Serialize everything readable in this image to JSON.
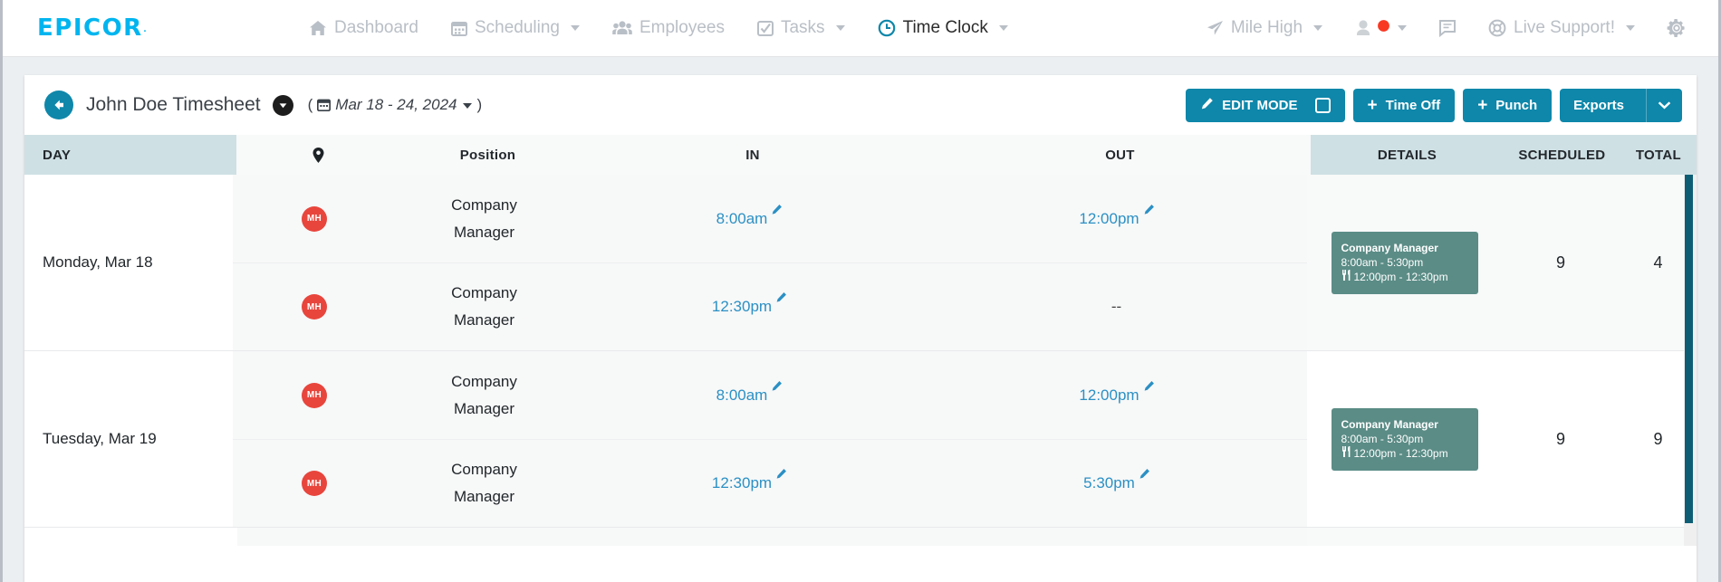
{
  "brand": {
    "logo": "EPICOR",
    "logo_color": "#00b5ef"
  },
  "topnav": {
    "items": [
      {
        "label": "Dashboard",
        "icon": "home-icon",
        "caret": false,
        "active": false
      },
      {
        "label": "Scheduling",
        "icon": "calendar-icon",
        "caret": true,
        "active": false
      },
      {
        "label": "Employees",
        "icon": "users-icon",
        "caret": false,
        "active": false
      },
      {
        "label": "Tasks",
        "icon": "check-square-icon",
        "caret": true,
        "active": false
      },
      {
        "label": "Time Clock",
        "icon": "clock-icon",
        "caret": true,
        "active": true
      }
    ],
    "right": {
      "location_label": "Mile High",
      "location_icon": "paper-plane-icon",
      "user_icon": "user-avatar-icon",
      "status_dot_color": "#f93822",
      "messages_icon": "chat-icon",
      "support_label": "Live Support!",
      "support_icon": "life-ring-icon",
      "settings_icon": "gear-icon"
    }
  },
  "timesheet": {
    "back_icon": "back-arrow-icon",
    "title": "John Doe Timesheet",
    "title_chevron_icon": "chevron-down-circle-icon",
    "date_open_paren": "(",
    "date_close_paren": ")",
    "date_icon": "calendar-icon",
    "date_range": "Mar 18 - 24, 2024",
    "actions": {
      "edit_mode_label": "EDIT MODE",
      "edit_mode_icon": "pencil-icon",
      "edit_mode_checked": false,
      "time_off_label": "Time Off",
      "punch_label": "Punch",
      "exports_label": "Exports",
      "exports_caret_icon": "chevron-down-icon"
    },
    "columns": {
      "day": "DAY",
      "pin": "location-pin-icon",
      "position": "Position",
      "in": "IN",
      "out": "OUT",
      "details": "DETAILS",
      "scheduled": "SCHEDULED",
      "total": "TOTAL"
    },
    "rows": [
      {
        "day": "Monday, Mar 18",
        "punches": [
          {
            "badge": "MH",
            "position_line1": "Company",
            "position_line2": "Manager",
            "in": "8:00am",
            "out": "12:00pm",
            "in_editable": true,
            "out_editable": true
          },
          {
            "badge": "MH",
            "position_line1": "Company",
            "position_line2": "Manager",
            "in": "12:30pm",
            "out": "--",
            "in_editable": true,
            "out_editable": false
          }
        ],
        "schedule": {
          "title": "Company Manager",
          "hours": "8:00am - 5:30pm",
          "break_icon": "utensils-icon",
          "break": "12:00pm - 12:30pm"
        },
        "scheduled": "9",
        "total": "4"
      },
      {
        "day": "Tuesday, Mar 19",
        "punches": [
          {
            "badge": "MH",
            "position_line1": "Company",
            "position_line2": "Manager",
            "in": "8:00am",
            "out": "12:00pm",
            "in_editable": true,
            "out_editable": true
          },
          {
            "badge": "MH",
            "position_line1": "Company",
            "position_line2": "Manager",
            "in": "12:30pm",
            "out": "5:30pm",
            "in_editable": true,
            "out_editable": true
          }
        ],
        "schedule": {
          "title": "Company Manager",
          "hours": "8:00am - 5:30pm",
          "break_icon": "utensils-icon",
          "break": "12:00pm - 12:30pm"
        },
        "scheduled": "9",
        "total": "9"
      },
      {
        "day": "",
        "punches": [],
        "schedule": null,
        "scheduled": "",
        "total": ""
      }
    ],
    "scrollbar": {
      "thumb_color": "#0d5e75"
    }
  }
}
